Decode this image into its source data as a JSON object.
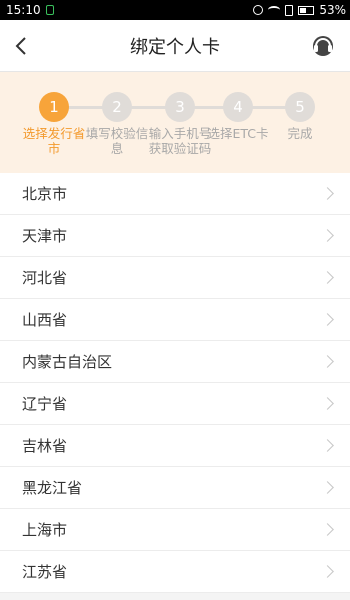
{
  "status_bar": {
    "time": "15:10",
    "battery": "53%",
    "battery_level": 0.53
  },
  "header": {
    "title": "绑定个人卡"
  },
  "steps": [
    {
      "number": "1",
      "label": "选择发行省市",
      "active": true
    },
    {
      "number": "2",
      "label": "填写校验信息",
      "active": false
    },
    {
      "number": "3",
      "label": "输入手机号获取验证码",
      "active": false
    },
    {
      "number": "4",
      "label": "选择ETC卡",
      "active": false
    },
    {
      "number": "5",
      "label": "完成",
      "active": false
    }
  ],
  "provinces": [
    "北京市",
    "天津市",
    "河北省",
    "山西省",
    "内蒙古自治区",
    "辽宁省",
    "吉林省",
    "黑龙江省",
    "上海市",
    "江苏省"
  ],
  "colors": {
    "accent": "#f7a43a",
    "step_bg": "#fdf1e4",
    "inactive": "#e0dcd8"
  },
  "icons": {
    "back": "chevron-left-icon",
    "support": "headset-icon",
    "row": "chevron-right-icon"
  }
}
